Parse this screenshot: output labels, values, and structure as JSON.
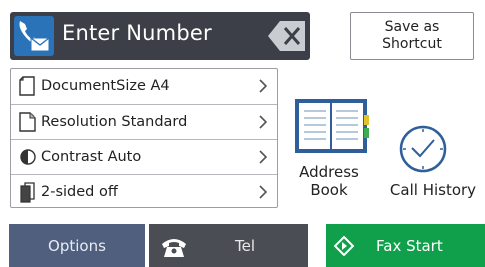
{
  "header": {
    "number_placeholder": "Enter Number",
    "shortcut_label": "Save as\nShortcut"
  },
  "settings": {
    "items": [
      {
        "label": "DocumentSize A4",
        "icon": "document-size-icon"
      },
      {
        "label": "Resolution Standard",
        "icon": "resolution-icon"
      },
      {
        "label": "Contrast Auto",
        "icon": "contrast-icon"
      },
      {
        "label": "2-sided off",
        "icon": "two-sided-icon"
      }
    ]
  },
  "shortcuts": {
    "address_book_label": "Address\nBook",
    "call_history_label": "Call History"
  },
  "bottom": {
    "options_label": "Options",
    "tel_label": "Tel",
    "fax_start_label": "Fax Start"
  },
  "colors": {
    "fax_start": "#10a04b",
    "options": "#4f5f7d",
    "tel": "#4a4d53",
    "header": "#3c3f47",
    "fax_badge": "#2a73b8"
  }
}
